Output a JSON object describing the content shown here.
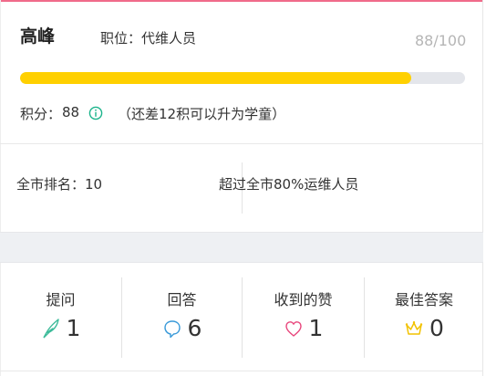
{
  "profile": {
    "name": "高峰",
    "position": "职位：代维人员",
    "score_text": "88/100",
    "progress_fraction": 0.88
  },
  "points": {
    "label": "积分：",
    "value": "88",
    "note": "（还差12积可以升为学童）"
  },
  "ranking": {
    "rank_text": "全市排名：10",
    "exceed_text": "超过全市80%运维人员"
  },
  "stats": [
    {
      "label": "提问",
      "value": "1",
      "icon": "feather-icon",
      "icon_color": "#3dbb9a"
    },
    {
      "label": "回答",
      "value": "6",
      "icon": "speech-bubble-icon",
      "icon_color": "#3a9ad9"
    },
    {
      "label": "收到的赞",
      "value": "1",
      "icon": "heart-icon",
      "icon_color": "#e8467c"
    },
    {
      "label": "最佳答案",
      "value": "0",
      "icon": "crown-icon",
      "icon_color": "#f2c200"
    }
  ],
  "colors": {
    "progress_fill": "#ffd000",
    "progress_track": "#e4e6eb",
    "accent_top": "#f06b8a",
    "info_icon": "#19b38a"
  }
}
